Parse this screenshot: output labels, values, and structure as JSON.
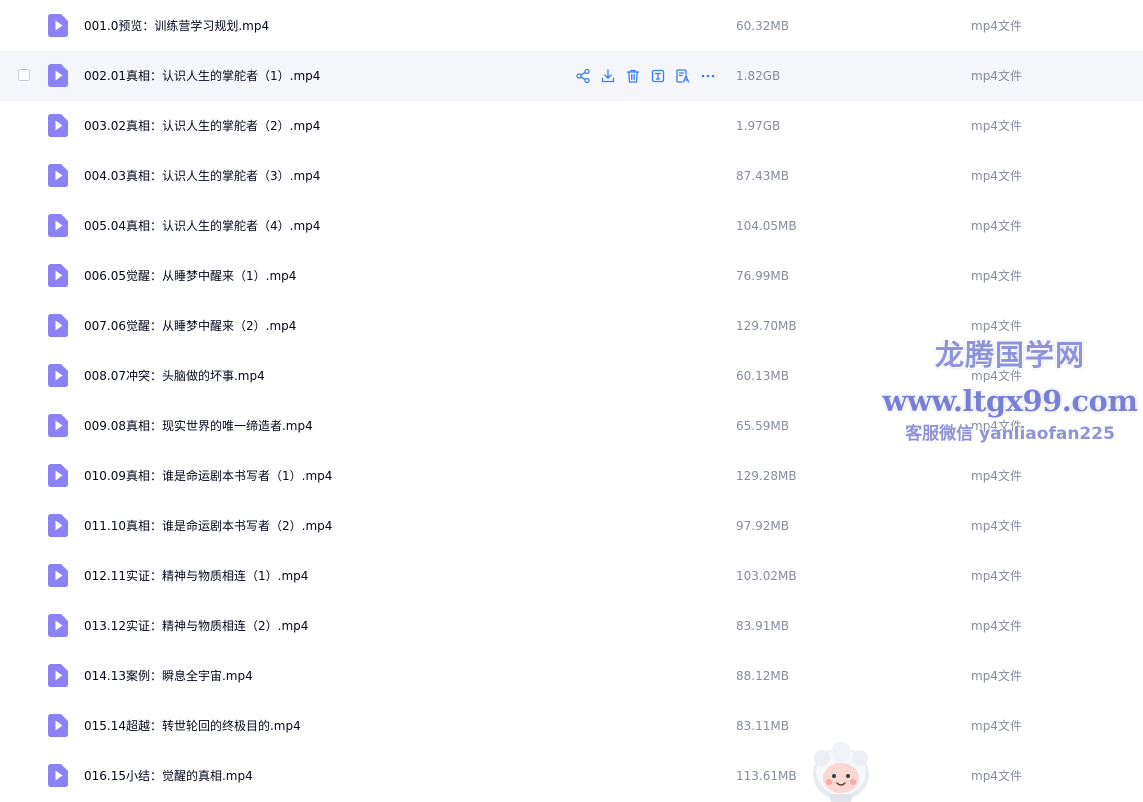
{
  "colors": {
    "video_icon": "#8b82f5",
    "action_icon": "#3a7cf5",
    "hover_row_bg": "#f5f6fa",
    "watermark": "#8f93d8"
  },
  "hover_actions": [
    "share-icon",
    "download-icon",
    "delete-icon",
    "rename-icon",
    "transcribe-icon",
    "more-icon"
  ],
  "files": [
    {
      "name": "001.0预览：训练营学习规划.mp4",
      "size": "60.32MB",
      "type": "mp4文件"
    },
    {
      "name": "002.01真相：认识人生的掌舵者（1）.mp4",
      "size": "1.82GB",
      "type": "mp4文件"
    },
    {
      "name": "003.02真相：认识人生的掌舵者（2）.mp4",
      "size": "1.97GB",
      "type": "mp4文件"
    },
    {
      "name": "004.03真相：认识人生的掌舵者（3）.mp4",
      "size": "87.43MB",
      "type": "mp4文件"
    },
    {
      "name": "005.04真相：认识人生的掌舵者（4）.mp4",
      "size": "104.05MB",
      "type": "mp4文件"
    },
    {
      "name": "006.05觉醒：从睡梦中醒来（1）.mp4",
      "size": "76.99MB",
      "type": "mp4文件"
    },
    {
      "name": "007.06觉醒：从睡梦中醒来（2）.mp4",
      "size": "129.70MB",
      "type": "mp4文件"
    },
    {
      "name": "008.07冲突：头脑做的坏事.mp4",
      "size": "60.13MB",
      "type": "mp4文件"
    },
    {
      "name": "009.08真相：现实世界的唯一缔造者.mp4",
      "size": "65.59MB",
      "type": "mp4文件"
    },
    {
      "name": "010.09真相：谁是命运剧本书写者（1）.mp4",
      "size": "129.28MB",
      "type": "mp4文件"
    },
    {
      "name": "011.10真相：谁是命运剧本书写者（2）.mp4",
      "size": "97.92MB",
      "type": "mp4文件"
    },
    {
      "name": "012.11实证：精神与物质相连（1）.mp4",
      "size": "103.02MB",
      "type": "mp4文件"
    },
    {
      "name": "013.12实证：精神与物质相连（2）.mp4",
      "size": "83.91MB",
      "type": "mp4文件"
    },
    {
      "name": "014.13案例：瞬息全宇宙.mp4",
      "size": "88.12MB",
      "type": "mp4文件"
    },
    {
      "name": "015.14超越：转世轮回的终极目的.mp4",
      "size": "83.11MB",
      "type": "mp4文件"
    },
    {
      "name": "016.15小结：觉醒的真相.mp4",
      "size": "113.61MB",
      "type": "mp4文件"
    }
  ],
  "watermark": {
    "title": "龙腾国学网",
    "url": "www.ltgx99.com",
    "contact": "客服微信 yanliaofan225"
  },
  "mascot_icon": "assistant-mascot-icon"
}
